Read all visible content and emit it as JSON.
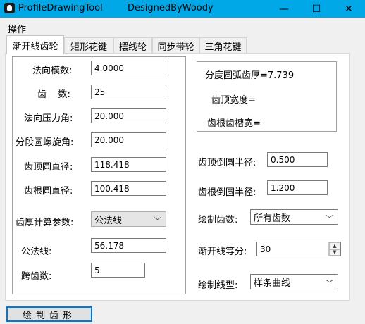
{
  "window": {
    "title_left": "ProfileDrawingTool",
    "title_mid": "DesignedByWoody",
    "minimize_glyph": "—",
    "maximize_glyph": "☐",
    "close_glyph": "✕"
  },
  "menu": {
    "ops_label": "操作"
  },
  "tabs": [
    {
      "label": "渐开线齿轮"
    },
    {
      "label": "矩形花键"
    },
    {
      "label": "摆线轮"
    },
    {
      "label": "同步带轮"
    },
    {
      "label": "三角花键"
    }
  ],
  "params": {
    "modulus_label": "法向模数:",
    "modulus_value": "4.0000",
    "teeth_label": "齿    数:",
    "teeth_value": "25",
    "pressure_label": "法向压力角:",
    "pressure_value": "20.000",
    "helix_label": "分段圆螺旋角:",
    "helix_value": "20.000",
    "tip_dia_label": "齿顶圆直径:",
    "tip_dia_value": "118.418",
    "root_dia_label": "齿根圆直径:",
    "root_dia_value": "100.418",
    "thickness_param_label": "齿厚计算参数:",
    "thickness_param_value": "公法线",
    "common_normal_label": "公法线:",
    "common_normal_value": "56.178",
    "span_teeth_label": "跨齿数:",
    "span_teeth_value": "5"
  },
  "results": {
    "arc_thickness": "分度圆弧齿厚=7.739",
    "tip_width": "齿顶宽度=",
    "root_groove": "齿根齿槽宽="
  },
  "right": {
    "tip_fillet_label": "齿顶倒圆半径:",
    "tip_fillet_value": "0.500",
    "root_fillet_label": "齿根倒圆半径:",
    "root_fillet_value": "1.200",
    "draw_teeth_label": "绘制齿数:",
    "draw_teeth_value": "所有齿数",
    "involute_div_label": "渐开线等分:",
    "involute_div_value": "30",
    "line_type_label": "绘制线型:",
    "line_type_value": "样条曲线"
  },
  "actions": {
    "draw_label": "绘制齿形"
  }
}
